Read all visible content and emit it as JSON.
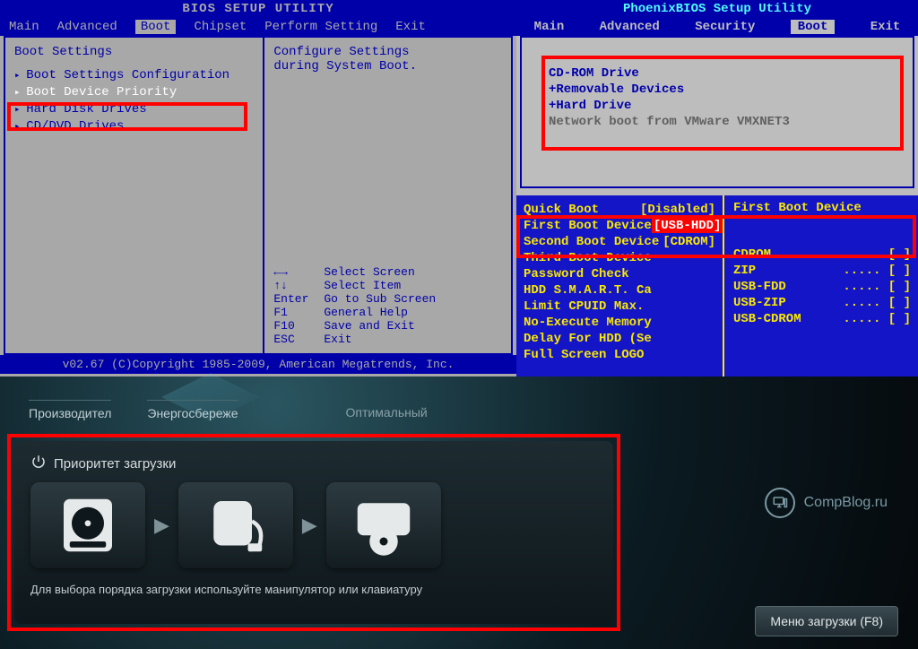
{
  "ami": {
    "title": "BIOS SETUP UTILITY",
    "menu": [
      "Main",
      "Advanced",
      "Boot",
      "Chipset",
      "Perform Setting",
      "Exit"
    ],
    "active_menu_index": 2,
    "section": "Boot Settings",
    "items": [
      "Boot Settings Configuration",
      "Boot Device Priority",
      "Hard Disk Drives",
      "CD/DVD Drives"
    ],
    "selected_item_index": 1,
    "help": {
      "line1": "Configure Settings",
      "line2": "during System Boot."
    },
    "keys": [
      {
        "k": "←→",
        "d": "Select Screen"
      },
      {
        "k": "↑↓",
        "d": "Select Item"
      },
      {
        "k": "Enter",
        "d": "Go to Sub Screen"
      },
      {
        "k": "F1",
        "d": "General Help"
      },
      {
        "k": "F10",
        "d": "Save and Exit"
      },
      {
        "k": "ESC",
        "d": "Exit"
      }
    ],
    "footer": "v02.67 (C)Copyright 1985-2009, American Megatrends, Inc."
  },
  "phoenix": {
    "title": "PhoenixBIOS Setup Utility",
    "menu": [
      "Main",
      "Advanced",
      "Security",
      "Boot",
      "Exit"
    ],
    "active_menu_index": 3,
    "lines": [
      {
        "txt": "CD-ROM Drive",
        "dim": false
      },
      {
        "txt": "+Removable Devices",
        "dim": false
      },
      {
        "txt": "+Hard Drive",
        "dim": false
      },
      {
        "txt": "Network boot from VMware VMXNET3",
        "dim": true
      }
    ]
  },
  "award": {
    "left_rows": [
      {
        "label": "Quick Boot",
        "value": "[Disabled]"
      },
      {
        "label": "First Boot Device",
        "value": "[USB-HDD]",
        "sel": true
      },
      {
        "label": "Second Boot Device",
        "value": "[CDROM]"
      },
      {
        "label": "Third Boot Device",
        "value": ""
      },
      {
        "label": "Password Check",
        "value": ""
      },
      {
        "label": "HDD S.M.A.R.T. Ca",
        "value": ""
      },
      {
        "label": "Limit CPUID Max.",
        "value": ""
      },
      {
        "label": "No-Execute Memory",
        "value": ""
      },
      {
        "label": "Delay For HDD (Se",
        "value": ""
      },
      {
        "label": "Full Screen LOGO",
        "value": ""
      }
    ],
    "right_header": "First Boot Device",
    "right_options": [
      "CDROM",
      "ZIP",
      "USB-FDD",
      "USB-ZIP",
      "USB-CDROM"
    ]
  },
  "uefi": {
    "tabs": [
      "Производител",
      "Энергосбереже",
      "Оптимальный"
    ],
    "panel_title": "Приоритет загрузки",
    "hint": "Для выбора порядка загрузки используйте манипулятор или клавиатуру",
    "watermark": "CompBlog.ru",
    "boot_menu_btn": "Меню загрузки (F8)",
    "devices": [
      "hdd-icon",
      "external-drive-icon",
      "optical-drive-icon"
    ]
  }
}
